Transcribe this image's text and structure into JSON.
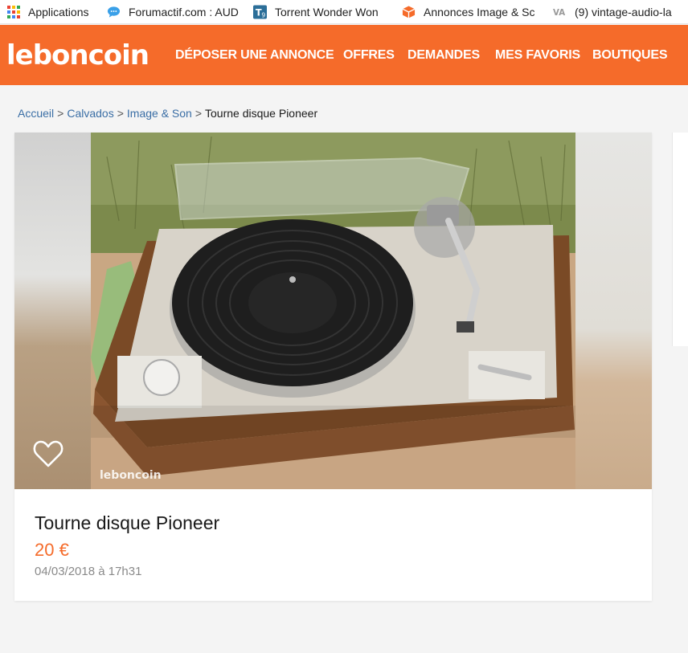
{
  "bookmarks": [
    {
      "label": "Applications",
      "icon": "apps-grid-icon"
    },
    {
      "label": "Forumactif.com : AUD",
      "icon": "chat-bubble-icon"
    },
    {
      "label": "Torrent Wonder Won",
      "icon": "t9-icon"
    },
    {
      "label": "Annonces Image & Sc",
      "icon": "package-box-icon"
    },
    {
      "label": "(9) vintage-audio-la",
      "icon": "va-icon"
    }
  ],
  "header": {
    "logo": "leboncoin",
    "nav": [
      {
        "label": "DÉPOSER UNE ANNONCE"
      },
      {
        "label": "OFFRES"
      },
      {
        "label": "DEMANDES"
      },
      {
        "label": "MES FAVORIS"
      },
      {
        "label": "BOUTIQUES"
      }
    ]
  },
  "breadcrumb": [
    {
      "label": "Accueil"
    },
    {
      "label": "Calvados"
    },
    {
      "label": "Image & Son"
    },
    {
      "label": "Tourne disque Pioneer"
    }
  ],
  "breadcrumb_separator": ">",
  "listing": {
    "photo_alt": "turntable-photo",
    "watermark": "leboncoin",
    "title": "Tourne disque Pioneer",
    "price": "20 €",
    "date": "04/03/2018 à 17h31"
  },
  "colors": {
    "brand": "#f56b2a",
    "link": "#3a6ea5"
  }
}
